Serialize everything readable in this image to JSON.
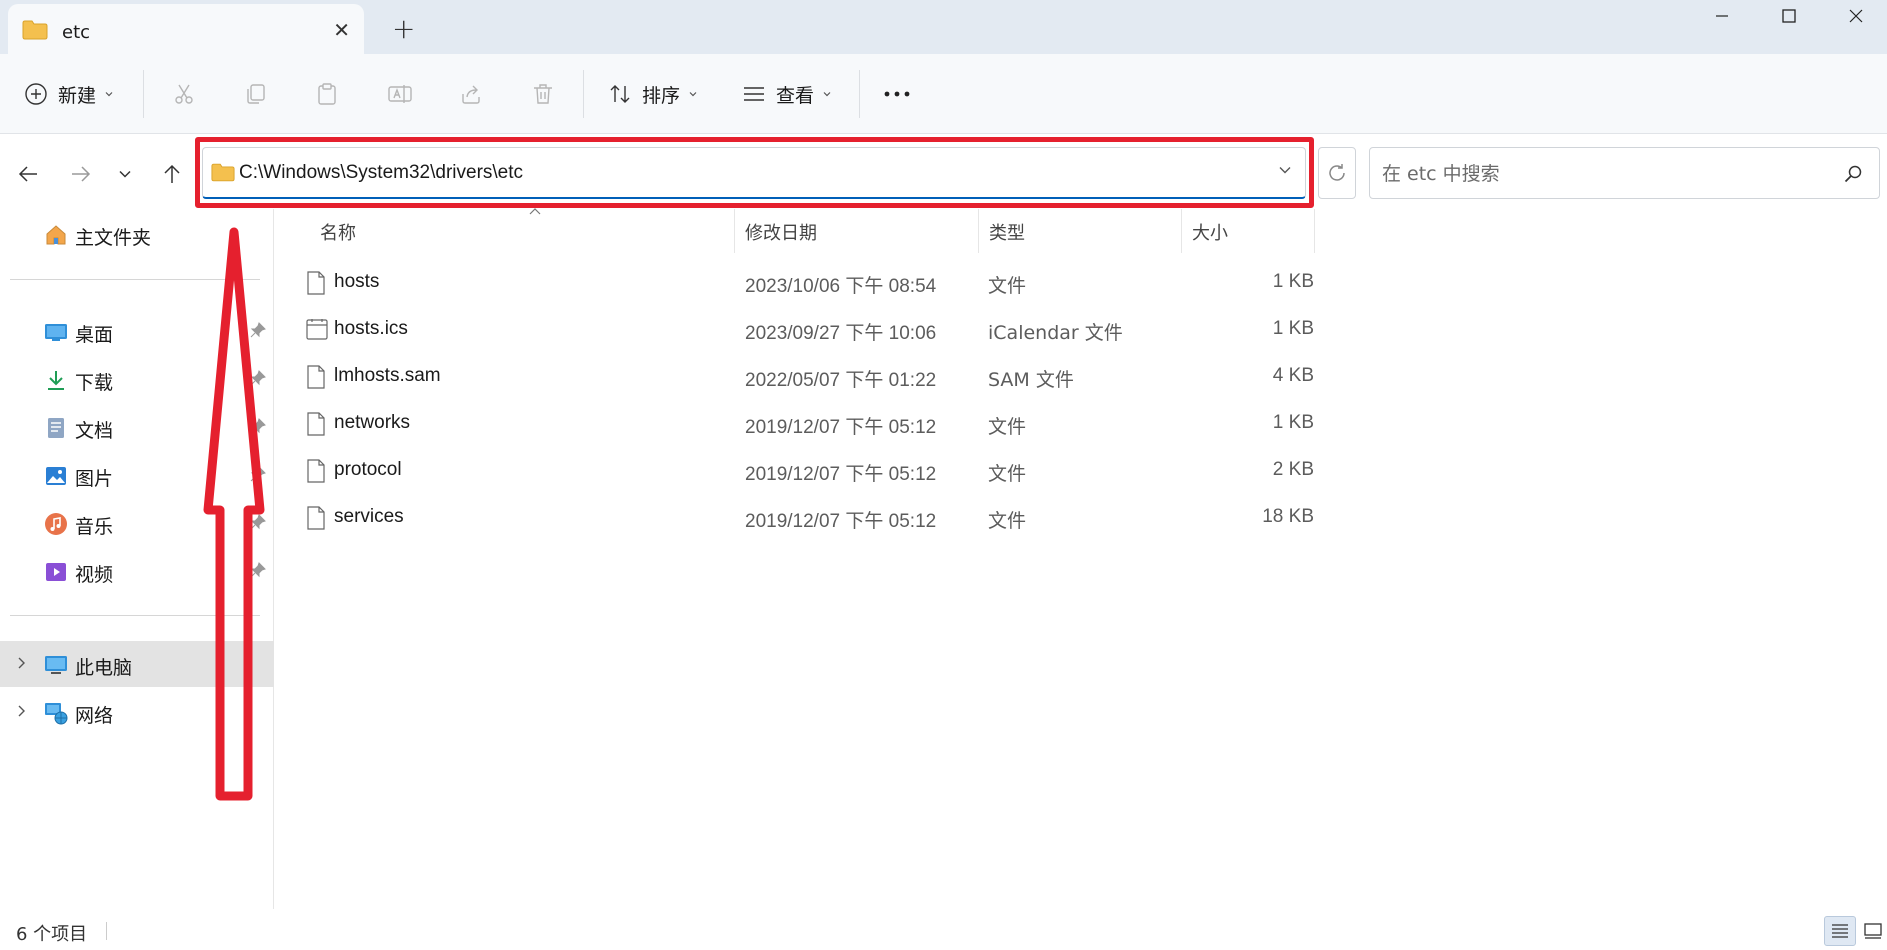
{
  "tab": {
    "title": "etc"
  },
  "toolbar": {
    "new_label": "新建",
    "sort_label": "排序",
    "view_label": "查看"
  },
  "address": {
    "path": "C:\\Windows\\System32\\drivers\\etc"
  },
  "search": {
    "placeholder": "在 etc 中搜索"
  },
  "sidebar": {
    "home": "主文件夹",
    "quick": [
      "桌面",
      "下载",
      "文档",
      "图片",
      "音乐",
      "视频"
    ],
    "this_pc": "此电脑",
    "network": "网络"
  },
  "columns": {
    "name": "名称",
    "date": "修改日期",
    "type": "类型",
    "size": "大小"
  },
  "files": [
    {
      "name": "hosts",
      "date": "2023/10/06 下午 08:54",
      "type": "文件",
      "size": "1 KB"
    },
    {
      "name": "hosts.ics",
      "date": "2023/09/27 下午 10:06",
      "type": "iCalendar 文件",
      "size": "1 KB"
    },
    {
      "name": "lmhosts.sam",
      "date": "2022/05/07 下午 01:22",
      "type": "SAM 文件",
      "size": "4 KB"
    },
    {
      "name": "networks",
      "date": "2019/12/07 下午 05:12",
      "type": "文件",
      "size": "1 KB"
    },
    {
      "name": "protocol",
      "date": "2019/12/07 下午 05:12",
      "type": "文件",
      "size": "2 KB"
    },
    {
      "name": "services",
      "date": "2019/12/07 下午 05:12",
      "type": "文件",
      "size": "18 KB"
    }
  ],
  "status": {
    "count": "6 个项目"
  },
  "colors": {
    "annotation_red": "#e5202e",
    "accent": "#005fb8",
    "folder": "#f4c04e"
  }
}
